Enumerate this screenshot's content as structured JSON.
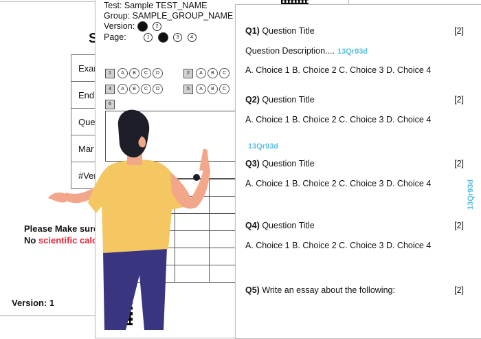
{
  "cover": {
    "title_fragment": "S",
    "rows": [
      "Exan",
      "EndI",
      "Que",
      "Mar",
      "#Ver"
    ],
    "note_line1": "Please Make sure",
    "note_line2_prefix": "No",
    "note_line2_red": "scientific calcu",
    "version": "Version: 1"
  },
  "answer_sheet": {
    "test": "Test: Sample TEST_NAME",
    "group": "Group: SAMPLE_GROUP_NAME",
    "version_label": "Version:",
    "version_bubble_2": "2",
    "page_label": "Page:",
    "page_bubbles": [
      "1",
      "",
      "3",
      "4"
    ],
    "question_numbers": [
      "1",
      "2",
      "4",
      "5",
      "6"
    ],
    "options": [
      "A",
      "B",
      "C",
      "D"
    ]
  },
  "questions": [
    {
      "label": "Q1)",
      "title": "Question Title",
      "mark": "[2]",
      "description": "Question Description....",
      "choices": "A. Choice 1  B. Choice 2  C. Choice 3  D. Choice 4"
    },
    {
      "label": "Q2)",
      "title": "Question Title",
      "mark": "[2]",
      "choices": "A. Choice 1  B. Choice 2  C. Choice 3  D. Choice 4"
    },
    {
      "label": "Q3)",
      "title": "Question Title",
      "mark": "[2]",
      "choices": "A. Choice 1  B. Choice 2  C. Choice 3  D. Choice 4"
    },
    {
      "label": "Q4)",
      "title": "Question Title",
      "mark": "[2]",
      "choices": "A. Choice 1  B. Choice 2  C. Choice 3  D. Choice 4"
    },
    {
      "label": "Q5)",
      "title": "Write an essay about the following:",
      "mark": "[2]"
    }
  ],
  "watermark": "13Qr93d",
  "colors": {
    "watermark": "#5bbfde",
    "red": "#e32636",
    "shirt": "#f5c763",
    "pants": "#3a3580",
    "hair": "#1e1e28",
    "skin": "#f3a78a"
  }
}
